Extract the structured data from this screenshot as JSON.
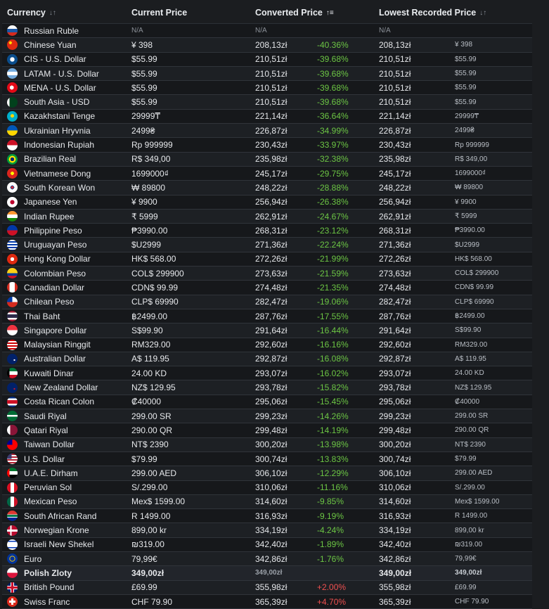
{
  "header": {
    "currency": "Currency",
    "current_price": "Current Price",
    "converted_price": "Converted Price",
    "lowest_recorded_price": "Lowest Recorded Price",
    "currency_sort_icon": "sort-icon",
    "converted_sort_icon": "sort-active-icon",
    "lowest_sort_icon": "sort-icon"
  },
  "rows": [
    {
      "name": "Russian Ruble",
      "flag": "ru",
      "price": "N/A",
      "converted": "N/A",
      "diff": "",
      "diff_type": "",
      "lowest": "N/A",
      "lowest_orig": "",
      "na": true
    },
    {
      "name": "Chinese Yuan",
      "flag": "cn",
      "price": "¥ 398",
      "converted": "208,13zł",
      "diff": "-40.36%",
      "diff_type": "neg",
      "lowest": "208,13zł",
      "lowest_orig": "¥ 398"
    },
    {
      "name": "CIS - U.S. Dollar",
      "flag": "cis",
      "price": "$55.99",
      "converted": "210,51zł",
      "diff": "-39.68%",
      "diff_type": "neg",
      "lowest": "210,51zł",
      "lowest_orig": "$55.99"
    },
    {
      "name": "LATAM - U.S. Dollar",
      "flag": "latam",
      "price": "$55.99",
      "converted": "210,51zł",
      "diff": "-39.68%",
      "diff_type": "neg",
      "lowest": "210,51zł",
      "lowest_orig": "$55.99"
    },
    {
      "name": "MENA - U.S. Dollar",
      "flag": "mena",
      "price": "$55.99",
      "converted": "210,51zł",
      "diff": "-39.68%",
      "diff_type": "neg",
      "lowest": "210,51zł",
      "lowest_orig": "$55.99"
    },
    {
      "name": "South Asia - USD",
      "flag": "sa",
      "price": "$55.99",
      "converted": "210,51zł",
      "diff": "-39.68%",
      "diff_type": "neg",
      "lowest": "210,51zł",
      "lowest_orig": "$55.99"
    },
    {
      "name": "Kazakhstani Tenge",
      "flag": "kz",
      "price": "29999₸",
      "converted": "221,14zł",
      "diff": "-36.64%",
      "diff_type": "neg",
      "lowest": "221,14zł",
      "lowest_orig": "29999₸"
    },
    {
      "name": "Ukrainian Hryvnia",
      "flag": "ua",
      "price": "2499₴",
      "converted": "226,87zł",
      "diff": "-34.99%",
      "diff_type": "neg",
      "lowest": "226,87zł",
      "lowest_orig": "2499₴"
    },
    {
      "name": "Indonesian Rupiah",
      "flag": "id",
      "price": "Rp 999999",
      "converted": "230,43zł",
      "diff": "-33.97%",
      "diff_type": "neg",
      "lowest": "230,43zł",
      "lowest_orig": "Rp 999999"
    },
    {
      "name": "Brazilian Real",
      "flag": "br",
      "price": "R$ 349,00",
      "converted": "235,98zł",
      "diff": "-32.38%",
      "diff_type": "neg",
      "lowest": "235,98zł",
      "lowest_orig": "R$ 349,00"
    },
    {
      "name": "Vietnamese Dong",
      "flag": "vn",
      "price": "1699000₫",
      "converted": "245,17zł",
      "diff": "-29.75%",
      "diff_type": "neg",
      "lowest": "245,17zł",
      "lowest_orig": "1699000₫"
    },
    {
      "name": "South Korean Won",
      "flag": "kr",
      "price": "₩ 89800",
      "converted": "248,22zł",
      "diff": "-28.88%",
      "diff_type": "neg",
      "lowest": "248,22zł",
      "lowest_orig": "₩ 89800"
    },
    {
      "name": "Japanese Yen",
      "flag": "jp",
      "price": "¥ 9900",
      "converted": "256,94zł",
      "diff": "-26.38%",
      "diff_type": "neg",
      "lowest": "256,94zł",
      "lowest_orig": "¥ 9900"
    },
    {
      "name": "Indian Rupee",
      "flag": "in",
      "price": "₹ 5999",
      "converted": "262,91zł",
      "diff": "-24.67%",
      "diff_type": "neg",
      "lowest": "262,91zł",
      "lowest_orig": "₹ 5999"
    },
    {
      "name": "Philippine Peso",
      "flag": "ph",
      "price": "₱3990.00",
      "converted": "268,31zł",
      "diff": "-23.12%",
      "diff_type": "neg",
      "lowest": "268,31zł",
      "lowest_orig": "₱3990.00"
    },
    {
      "name": "Uruguayan Peso",
      "flag": "uy",
      "price": "$U2999",
      "converted": "271,36zł",
      "diff": "-22.24%",
      "diff_type": "neg",
      "lowest": "271,36zł",
      "lowest_orig": "$U2999"
    },
    {
      "name": "Hong Kong Dollar",
      "flag": "hk",
      "price": "HK$ 568.00",
      "converted": "272,26zł",
      "diff": "-21.99%",
      "diff_type": "neg",
      "lowest": "272,26zł",
      "lowest_orig": "HK$ 568.00"
    },
    {
      "name": "Colombian Peso",
      "flag": "co",
      "price": "COL$ 299900",
      "converted": "273,63zł",
      "diff": "-21.59%",
      "diff_type": "neg",
      "lowest": "273,63zł",
      "lowest_orig": "COL$ 299900"
    },
    {
      "name": "Canadian Dollar",
      "flag": "ca",
      "price": "CDN$ 99.99",
      "converted": "274,48zł",
      "diff": "-21.35%",
      "diff_type": "neg",
      "lowest": "274,48zł",
      "lowest_orig": "CDN$ 99.99"
    },
    {
      "name": "Chilean Peso",
      "flag": "cl",
      "price": "CLP$ 69990",
      "converted": "282,47zł",
      "diff": "-19.06%",
      "diff_type": "neg",
      "lowest": "282,47zł",
      "lowest_orig": "CLP$ 69990"
    },
    {
      "name": "Thai Baht",
      "flag": "th",
      "price": "฿2499.00",
      "converted": "287,76zł",
      "diff": "-17.55%",
      "diff_type": "neg",
      "lowest": "287,76zł",
      "lowest_orig": "฿2499.00"
    },
    {
      "name": "Singapore Dollar",
      "flag": "sg",
      "price": "S$99.90",
      "converted": "291,64zł",
      "diff": "-16.44%",
      "diff_type": "neg",
      "lowest": "291,64zł",
      "lowest_orig": "S$99.90"
    },
    {
      "name": "Malaysian Ringgit",
      "flag": "my",
      "price": "RM329.00",
      "converted": "292,60zł",
      "diff": "-16.16%",
      "diff_type": "neg",
      "lowest": "292,60zł",
      "lowest_orig": "RM329.00"
    },
    {
      "name": "Australian Dollar",
      "flag": "au",
      "price": "A$ 119.95",
      "converted": "292,87zł",
      "diff": "-16.08%",
      "diff_type": "neg",
      "lowest": "292,87zł",
      "lowest_orig": "A$ 119.95"
    },
    {
      "name": "Kuwaiti Dinar",
      "flag": "kw",
      "price": "24.00 KD",
      "converted": "293,07zł",
      "diff": "-16.02%",
      "diff_type": "neg",
      "lowest": "293,07zł",
      "lowest_orig": "24.00 KD"
    },
    {
      "name": "New Zealand Dollar",
      "flag": "nz",
      "price": "NZ$ 129.95",
      "converted": "293,78zł",
      "diff": "-15.82%",
      "diff_type": "neg",
      "lowest": "293,78zł",
      "lowest_orig": "NZ$ 129.95"
    },
    {
      "name": "Costa Rican Colon",
      "flag": "cr",
      "price": "₡40000",
      "converted": "295,06zł",
      "diff": "-15.45%",
      "diff_type": "neg",
      "lowest": "295,06zł",
      "lowest_orig": "₡40000"
    },
    {
      "name": "Saudi Riyal",
      "flag": "sar",
      "price": "299.00 SR",
      "converted": "299,23zł",
      "diff": "-14.26%",
      "diff_type": "neg",
      "lowest": "299,23zł",
      "lowest_orig": "299.00 SR"
    },
    {
      "name": "Qatari Riyal",
      "flag": "qa",
      "price": "290.00 QR",
      "converted": "299,48zł",
      "diff": "-14.19%",
      "diff_type": "neg",
      "lowest": "299,48zł",
      "lowest_orig": "290.00 QR"
    },
    {
      "name": "Taiwan Dollar",
      "flag": "tw",
      "price": "NT$ 2390",
      "converted": "300,20zł",
      "diff": "-13.98%",
      "diff_type": "neg",
      "lowest": "300,20zł",
      "lowest_orig": "NT$ 2390"
    },
    {
      "name": "U.S. Dollar",
      "flag": "us",
      "price": "$79.99",
      "converted": "300,74zł",
      "diff": "-13.83%",
      "diff_type": "neg",
      "lowest": "300,74zł",
      "lowest_orig": "$79.99"
    },
    {
      "name": "U.A.E. Dirham",
      "flag": "ae",
      "price": "299.00 AED",
      "converted": "306,10zł",
      "diff": "-12.29%",
      "diff_type": "neg",
      "lowest": "306,10zł",
      "lowest_orig": "299.00 AED"
    },
    {
      "name": "Peruvian Sol",
      "flag": "pe",
      "price": "S/.299.00",
      "converted": "310,06zł",
      "diff": "-11.16%",
      "diff_type": "neg",
      "lowest": "310,06zł",
      "lowest_orig": "S/.299.00"
    },
    {
      "name": "Mexican Peso",
      "flag": "mx",
      "price": "Mex$ 1599.00",
      "converted": "314,60zł",
      "diff": "-9.85%",
      "diff_type": "neg",
      "lowest": "314,60zł",
      "lowest_orig": "Mex$ 1599.00"
    },
    {
      "name": "South African Rand",
      "flag": "za",
      "price": "R 1499.00",
      "converted": "316,93zł",
      "diff": "-9.19%",
      "diff_type": "neg",
      "lowest": "316,93zł",
      "lowest_orig": "R 1499.00"
    },
    {
      "name": "Norwegian Krone",
      "flag": "no",
      "price": "899,00 kr",
      "converted": "334,19zł",
      "diff": "-4.24%",
      "diff_type": "neg",
      "lowest": "334,19zł",
      "lowest_orig": "899,00 kr"
    },
    {
      "name": "Israeli New Shekel",
      "flag": "il",
      "price": "₪319.00",
      "converted": "342,40zł",
      "diff": "-1.89%",
      "diff_type": "neg",
      "lowest": "342,40zł",
      "lowest_orig": "₪319.00"
    },
    {
      "name": "Euro",
      "flag": "eu",
      "price": "79,99€",
      "converted": "342,86zł",
      "diff": "-1.76%",
      "diff_type": "neg",
      "lowest": "342,86zł",
      "lowest_orig": "79,99€"
    },
    {
      "name": "Polish Zloty",
      "flag": "pl",
      "price": "349,00zł",
      "converted": "349,00zł",
      "diff": "",
      "diff_type": "",
      "lowest": "349,00zł",
      "lowest_orig": "349,00zł",
      "highlight": true
    },
    {
      "name": "British Pound",
      "flag": "gb",
      "price": "£69.99",
      "converted": "355,98zł",
      "diff": "+2.00%",
      "diff_type": "pos",
      "lowest": "355,98zł",
      "lowest_orig": "£69.99"
    },
    {
      "name": "Swiss Franc",
      "flag": "ch",
      "price": "CHF 79.90",
      "converted": "365,39zł",
      "diff": "+4.70%",
      "diff_type": "pos",
      "lowest": "365,39zł",
      "lowest_orig": "CHF 79.90"
    }
  ],
  "colors": {
    "negative": "#6cc644",
    "positive": "#f05050",
    "row_border": "#30343a",
    "background": "#1b1d20"
  }
}
